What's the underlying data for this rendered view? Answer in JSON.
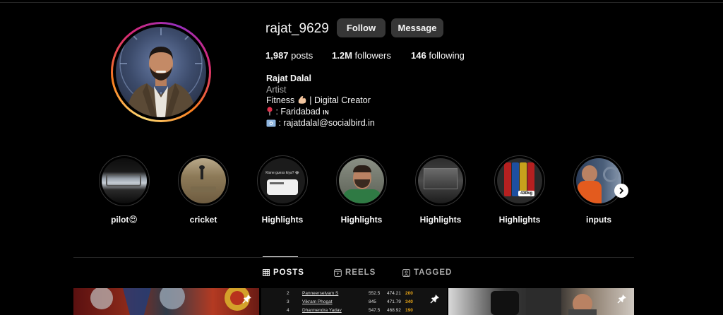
{
  "profile": {
    "username": "rajat_9629",
    "follow_label": "Follow",
    "message_label": "Message",
    "stats": {
      "posts_count": "1,987",
      "posts_label": "posts",
      "followers_count": "1.2M",
      "followers_label": "followers",
      "following_count": "146",
      "following_label": "following"
    },
    "bio": {
      "name": "Rajat Dalal",
      "category": "Artist",
      "line1_before": "Fitness",
      "line1_after": "| Digital Creator",
      "line2": ": Faridabad",
      "line2_flag": "IN",
      "line3": ": rajatdalal@socialbird.in"
    },
    "story_ring_colors": [
      "#feda75",
      "#fa7e1e",
      "#d62976",
      "#962fbf"
    ]
  },
  "highlights": [
    {
      "label": "pilot😍",
      "icon": "plane-window-thumb"
    },
    {
      "label": "cricket",
      "icon": "cricket-field-thumb"
    },
    {
      "label": "Highlights",
      "icon": "chat-screenshot-thumb",
      "thumb_text": "Kisne guess kiya? 😂"
    },
    {
      "label": "Highlights",
      "icon": "selfie-thumb"
    },
    {
      "label": "Highlights",
      "icon": "window-view-thumb"
    },
    {
      "label": "Highlights",
      "icon": "weight-plates-thumb",
      "thumb_text": "430kg"
    },
    {
      "label": "inputs",
      "icon": "gym-selfie-thumb"
    }
  ],
  "tabs": [
    {
      "label": "POSTS",
      "icon": "grid-icon",
      "active": true
    },
    {
      "label": "REELS",
      "icon": "reels-icon",
      "active": false
    },
    {
      "label": "TAGGED",
      "icon": "tagged-icon",
      "active": false
    }
  ],
  "posts": {
    "leaderboard_rows": [
      {
        "rank": "2",
        "name": "Panneerselvam S",
        "v1": "552.5",
        "v2": "474.21",
        "score": "200"
      },
      {
        "rank": "3",
        "name": "Vikram Phogat",
        "v1": "845",
        "v2": "471.79",
        "score": "340"
      },
      {
        "rank": "4",
        "name": "Dharmendra Yadav",
        "v1": "547.5",
        "v2": "468.92",
        "score": "190"
      }
    ]
  }
}
